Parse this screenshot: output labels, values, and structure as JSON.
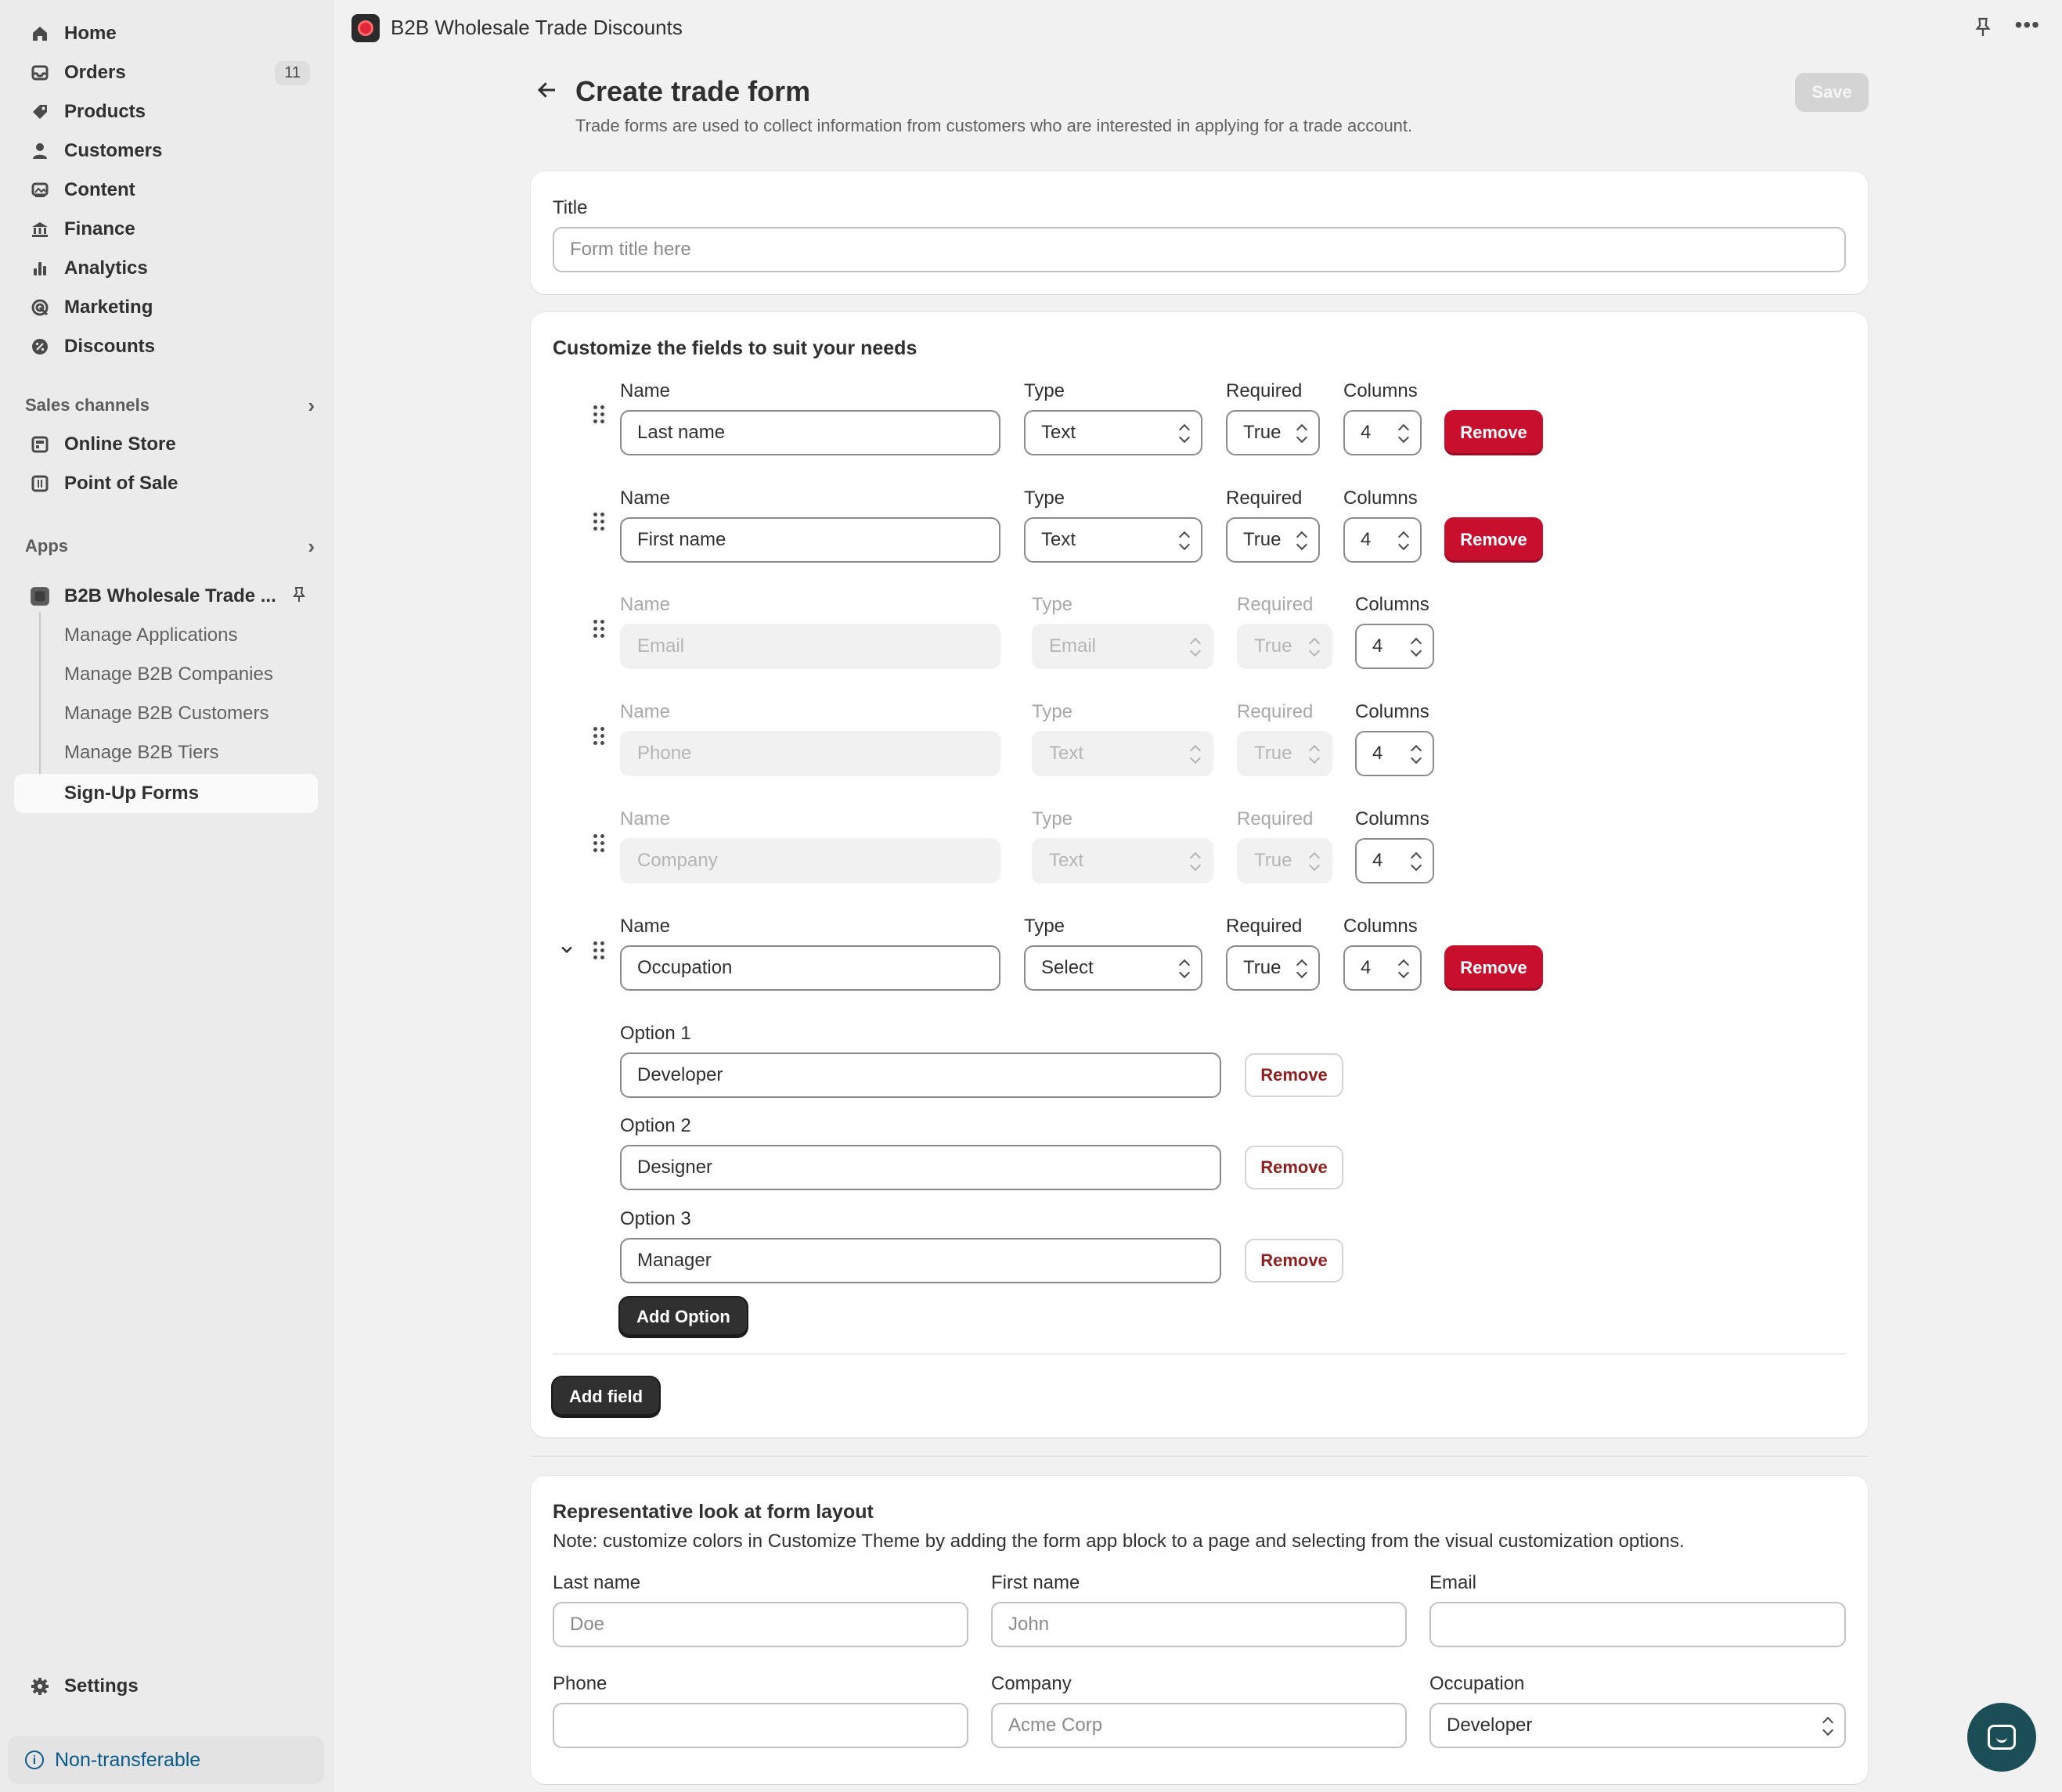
{
  "app": {
    "title": "B2B Wholesale Trade Discounts"
  },
  "nav": {
    "home": "Home",
    "orders": "Orders",
    "orders_badge": "11",
    "products": "Products",
    "customers": "Customers",
    "content": "Content",
    "finance": "Finance",
    "analytics": "Analytics",
    "marketing": "Marketing",
    "discounts": "Discounts",
    "sales_channels": "Sales channels",
    "online_store": "Online Store",
    "point_of_sale": "Point of Sale",
    "apps": "Apps",
    "app_name": "B2B Wholesale Trade ...",
    "sub": {
      "manage_applications": "Manage Applications",
      "manage_companies": "Manage B2B Companies",
      "manage_customers": "Manage B2B Customers",
      "manage_tiers": "Manage B2B Tiers",
      "signup_forms": "Sign-Up Forms"
    },
    "settings": "Settings",
    "non_transferable": "Non-transferable"
  },
  "page": {
    "title": "Create trade form",
    "subtitle": "Trade forms are used to collect information from customers who are interested in applying for a trade account.",
    "save": "Save"
  },
  "title_card": {
    "label": "Title",
    "placeholder": "Form title here"
  },
  "fields_card": {
    "heading": "Customize the fields to suit your needs",
    "col_name": "Name",
    "col_type": "Type",
    "col_required": "Required",
    "col_columns": "Columns",
    "remove": "Remove",
    "rows": [
      {
        "name": "Last name",
        "type": "Text",
        "required": "True",
        "columns": "4"
      },
      {
        "name": "First name",
        "type": "Text",
        "required": "True",
        "columns": "4"
      },
      {
        "name": "Email",
        "type": "Email",
        "required": "True",
        "columns": "4"
      },
      {
        "name": "Phone",
        "type": "Text",
        "required": "True",
        "columns": "4"
      },
      {
        "name": "Company",
        "type": "Text",
        "required": "True",
        "columns": "4"
      },
      {
        "name": "Occupation",
        "type": "Select",
        "required": "True",
        "columns": "4"
      }
    ],
    "options": [
      {
        "label": "Option 1",
        "value": "Developer"
      },
      {
        "label": "Option 2",
        "value": "Designer"
      },
      {
        "label": "Option 3",
        "value": "Manager"
      }
    ],
    "add_option": "Add Option",
    "add_field": "Add field"
  },
  "preview_card": {
    "heading": "Representative look at form layout",
    "note": "Note: customize colors in Customize Theme by adding the form app block to a page and selecting from the visual customization options.",
    "fields": [
      {
        "label": "Last name",
        "placeholder": "Doe"
      },
      {
        "label": "First name",
        "placeholder": "John"
      },
      {
        "label": "Email",
        "placeholder": ""
      },
      {
        "label": "Phone",
        "placeholder": ""
      },
      {
        "label": "Company",
        "placeholder": "Acme Corp"
      },
      {
        "label": "Occupation",
        "value": "Developer"
      }
    ]
  },
  "colors": {
    "accent_red": "#c8102e",
    "sidebar_bg": "#ebebeb",
    "page_bg": "#f1f1f1",
    "link_blue": "#0b5c8a"
  }
}
